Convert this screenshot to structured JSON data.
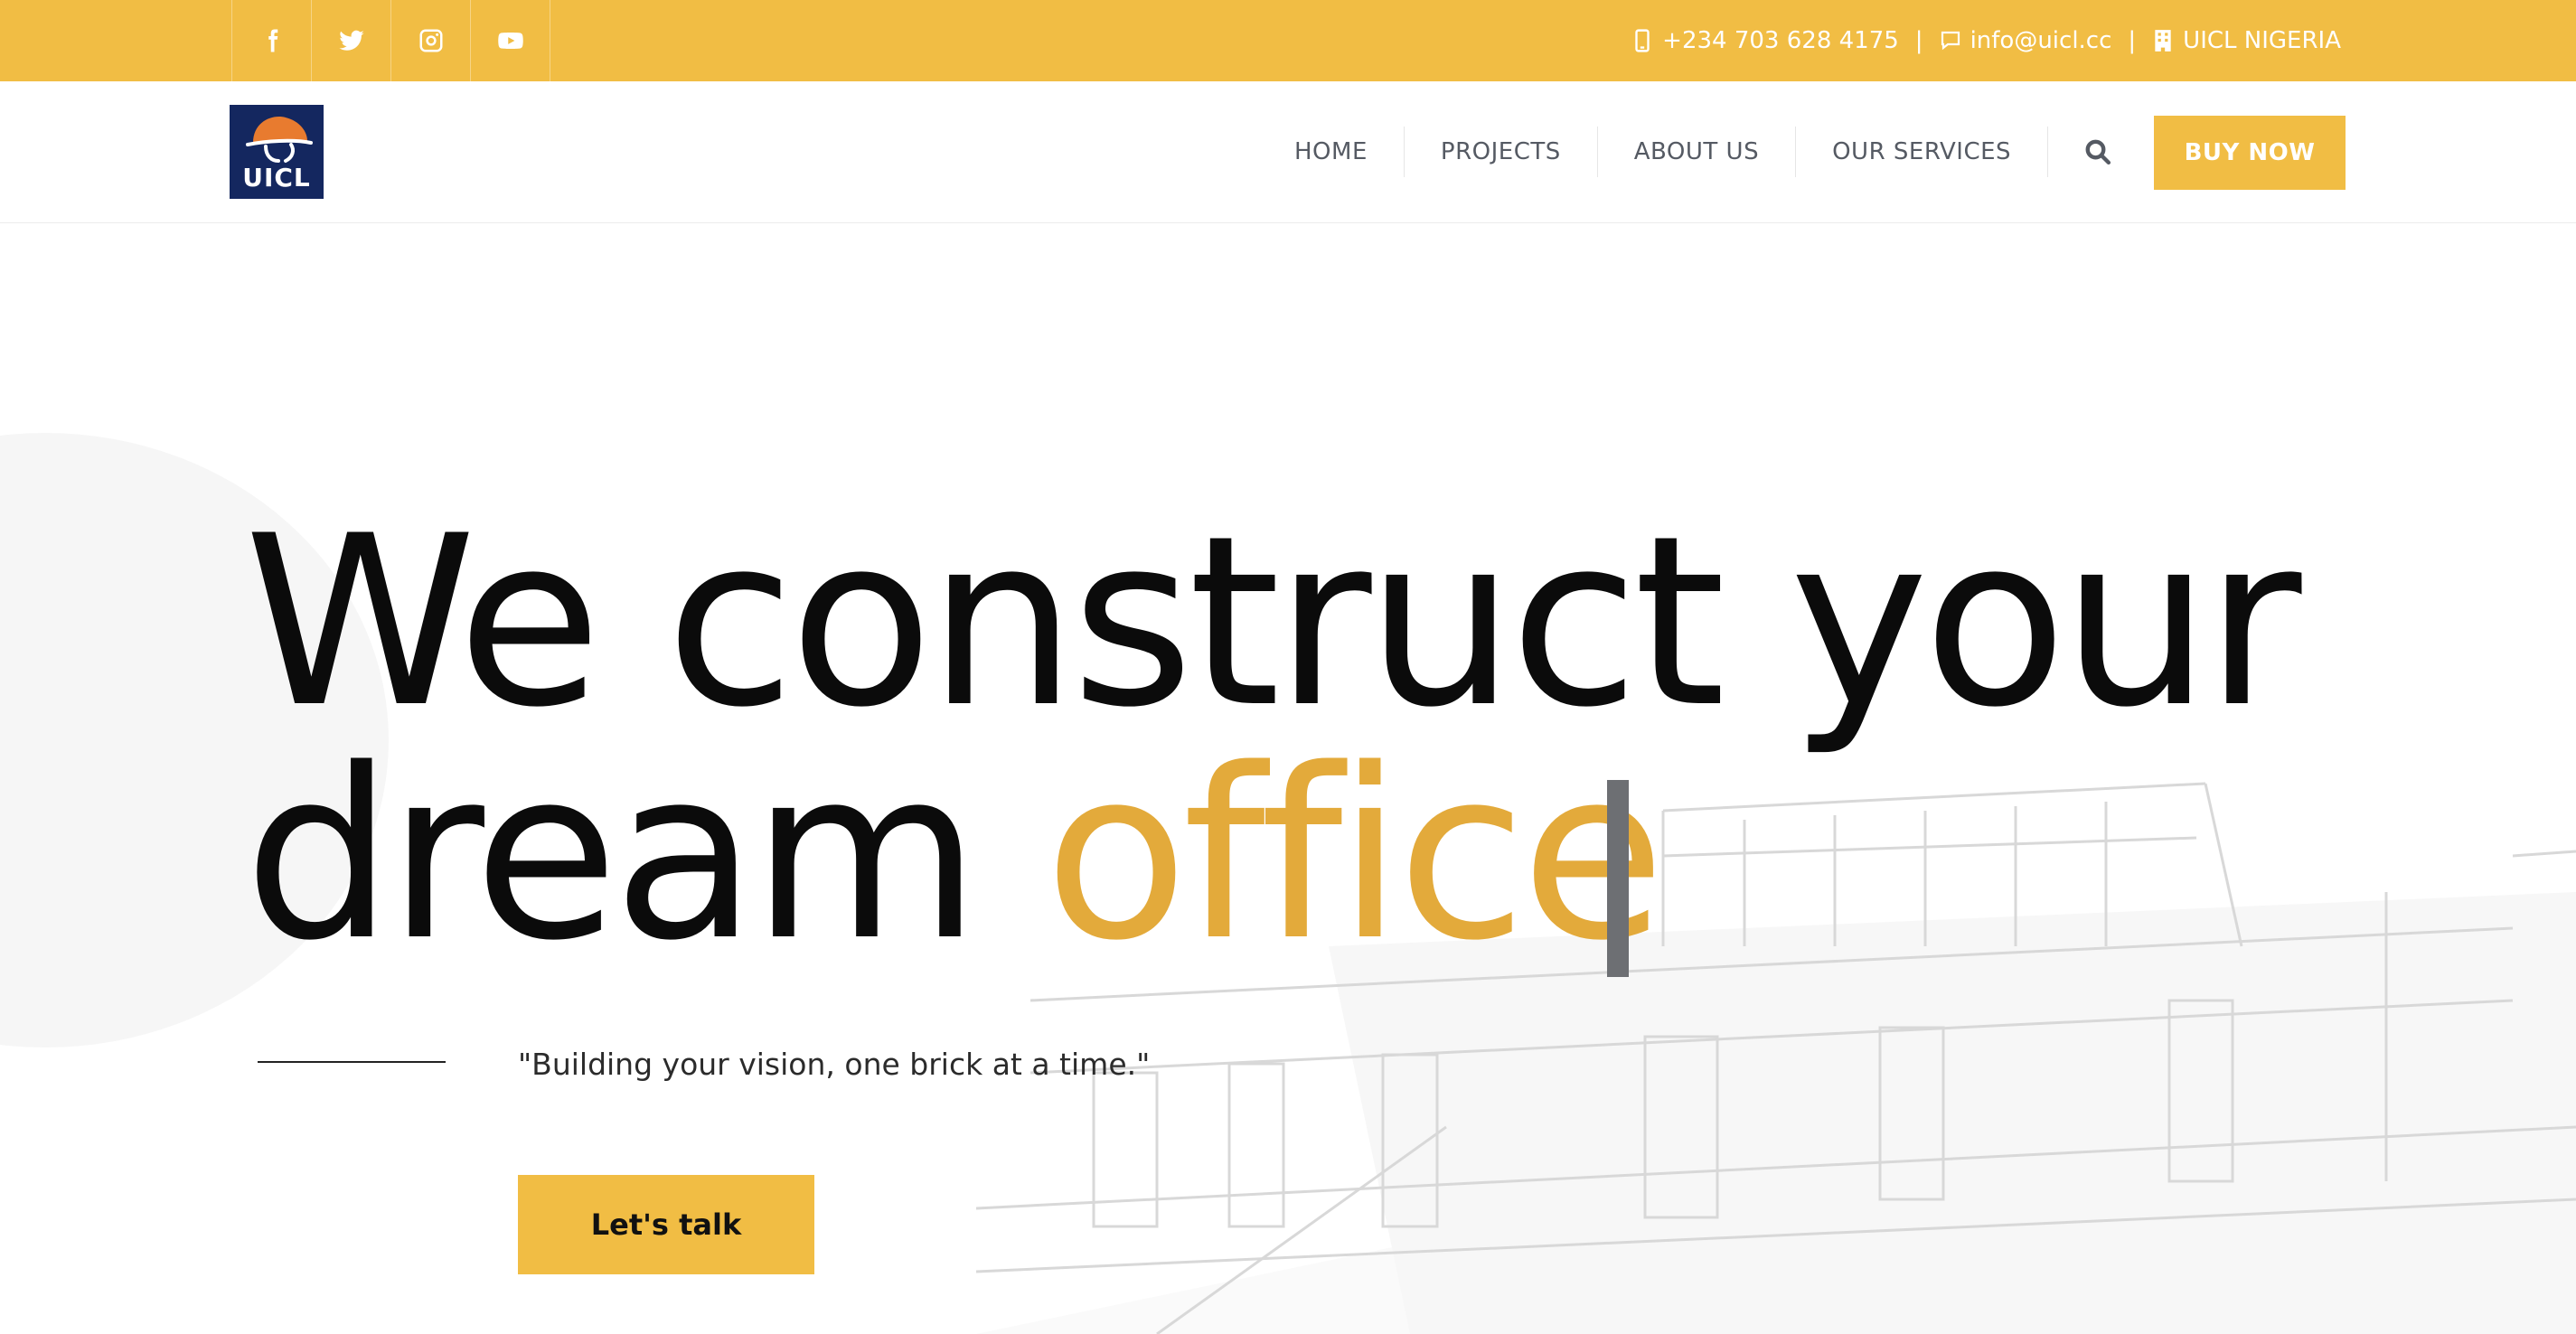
{
  "colors": {
    "brand_yellow": "#f1bd44",
    "accent_word": "#e3aa3b",
    "logo_navy": "#14275f",
    "nav_text": "#555a63",
    "headline_text": "#0b0b0b"
  },
  "topbar": {
    "social_icons": [
      "facebook-icon",
      "twitter-icon",
      "instagram-icon",
      "youtube-icon"
    ],
    "phone": "+234 703 628 4175",
    "email": "info@uicl.cc",
    "company": "UICL NIGERIA",
    "separator": "|"
  },
  "header": {
    "logo_text": "UICL",
    "nav": [
      "HOME",
      "PROJECTS",
      "ABOUT US",
      "OUR SERVICES"
    ],
    "buy_now": "BUY NOW"
  },
  "hero": {
    "headline_line1": "We construct your",
    "headline_line2_prefix": "dream ",
    "headline_accent": "office",
    "tagline": "\"Building your vision, one brick at a time.\"",
    "cta": "Let's talk"
  }
}
